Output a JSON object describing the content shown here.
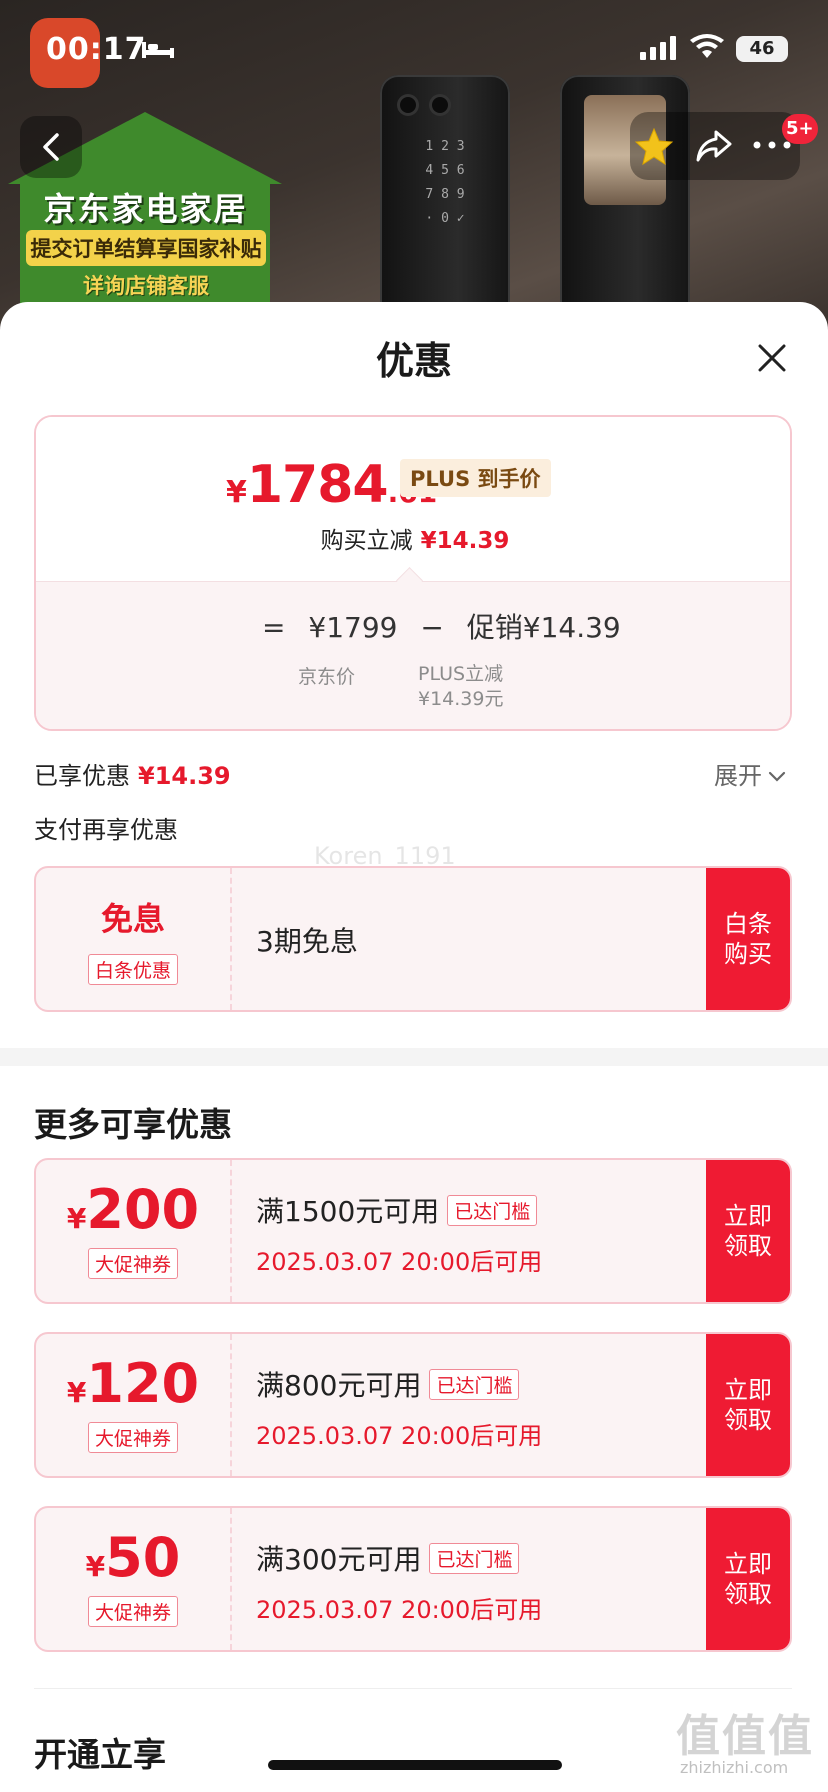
{
  "status_bar": {
    "time": "00:17",
    "battery": "46"
  },
  "top_bar": {
    "badge": "5+"
  },
  "banner": {
    "title": "京东家电家居",
    "line1": "提交订单结算享国家补贴",
    "line2": "详询店铺客服"
  },
  "sheet": {
    "title": "优惠"
  },
  "price": {
    "currency": "¥",
    "integer": "1784",
    "decimal": ".61",
    "plus_tag": "PLUS 到手价",
    "reduce_label": "购买立减",
    "reduce_value": "¥14.39"
  },
  "formula": {
    "equals": "=",
    "jd_price": "¥1799",
    "minus": "−",
    "promo_label": "促销",
    "promo_value": "¥14.39",
    "jd_price_label": "京东价",
    "plus_reduce_label": "PLUS立减",
    "plus_reduce_value": "¥14.39元"
  },
  "enjoyed": {
    "label": "已享优惠",
    "value": "¥14.39",
    "expand": "展开"
  },
  "pay_more": {
    "label": "支付再享优惠",
    "watermark": "Koren_1191"
  },
  "baitiao": {
    "title": "免息",
    "tag": "白条优惠",
    "desc": "3期免息",
    "action": "白条购买"
  },
  "more": {
    "title": "更多可享优惠",
    "coupons": [
      {
        "currency": "¥",
        "amount": "200",
        "tag": "大促神券",
        "condition": "满1500元可用",
        "status": "已达门槛",
        "date": "2025.03.07 20:00后可用",
        "action": "立即领取"
      },
      {
        "currency": "¥",
        "amount": "120",
        "tag": "大促神券",
        "condition": "满800元可用",
        "status": "已达门槛",
        "date": "2025.03.07 20:00后可用",
        "action": "立即领取"
      },
      {
        "currency": "¥",
        "amount": "50",
        "tag": "大促神券",
        "condition": "满300元可用",
        "status": "已达门槛",
        "date": "2025.03.07 20:00后可用",
        "action": "立即领取"
      }
    ]
  },
  "open": {
    "title": "开通立享"
  },
  "watermark_site": {
    "logo": "值值值",
    "url": "zhizhizhi.com"
  },
  "colors": {
    "accent_red": "#ef1b33",
    "price_red": "#e6192c",
    "card_border": "#f6c7cf",
    "card_bg": "#fbf3f4"
  }
}
